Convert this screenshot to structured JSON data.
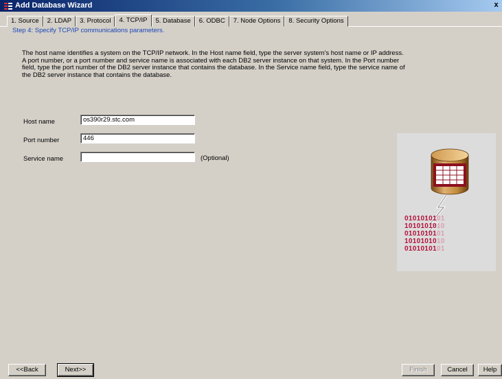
{
  "window": {
    "title": "Add Database Wizard",
    "close_label": "x"
  },
  "tabs": [
    {
      "label": "1. Source",
      "active": false
    },
    {
      "label": "2. LDAP",
      "active": false
    },
    {
      "label": "3. Protocol",
      "active": false
    },
    {
      "label": "4. TCP/IP",
      "active": true
    },
    {
      "label": "5. Database",
      "active": false
    },
    {
      "label": "6. ODBC",
      "active": false
    },
    {
      "label": "7. Node Options",
      "active": false
    },
    {
      "label": "8. Security Options",
      "active": false
    }
  ],
  "step_heading": "Step 4: Specify TCP/IP communications parameters.",
  "description": "The host name identifies a system on the TCP/IP network.  In the Host name field, type the server system's host name or IP address.   A port number, or a port number and service name is associated with each DB2 server instance on that system.  In the Port number field, type the port number of the DB2 server instance that contains the database.  In the Service name field, type the service name of the DB2 server instance that contains the database.",
  "form": {
    "host_name": {
      "label": "Host name",
      "value": "os390r29.stc.com"
    },
    "port_number": {
      "label": "Port number",
      "value": "446"
    },
    "service_name": {
      "label": "Service name",
      "value": "",
      "note": "(Optional)"
    }
  },
  "illustration": {
    "binary_lines": [
      "01010101",
      "10101010",
      "01010101",
      "10101010",
      "01010101"
    ],
    "faded_digits": [
      "01",
      "10",
      "01",
      "10",
      "01"
    ]
  },
  "buttons": {
    "back": "<<Back",
    "next": "Next>>",
    "finish": "Finish",
    "cancel": "Cancel",
    "help": "Help"
  },
  "colors": {
    "step_text": "#1c45b5",
    "binary_text": "#b0103a",
    "dialog_bg": "#d4d0c8"
  }
}
